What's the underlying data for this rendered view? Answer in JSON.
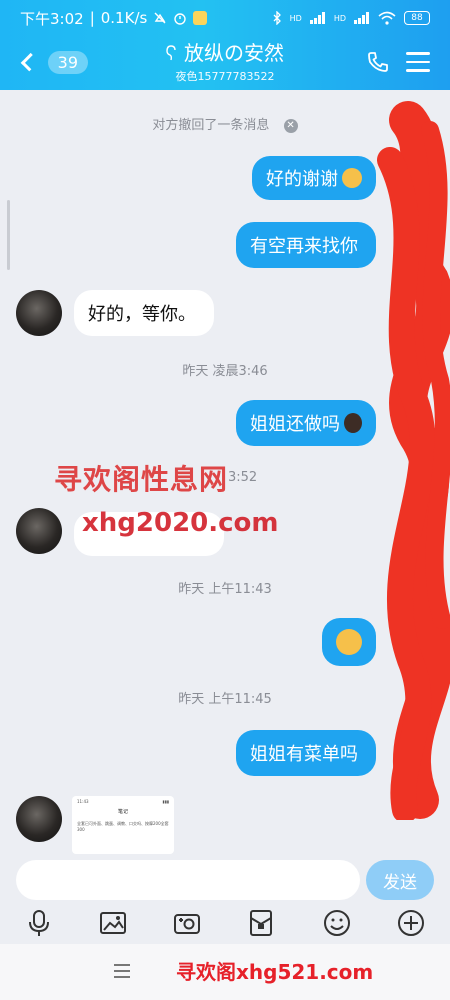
{
  "status_bar": {
    "time": "下午3:02",
    "speed": "0.1K/s",
    "battery": "88",
    "signal1": "HD",
    "signal2": "HD"
  },
  "header": {
    "back_count": "39",
    "title": "放纵の安然",
    "subtitle": "夜色15777783522"
  },
  "chat": {
    "recall_notice": "对方撤回了一条消息",
    "messages": [
      {
        "side": "me",
        "text": "好的谢谢"
      },
      {
        "side": "me",
        "text": "有空再来找你"
      },
      {
        "side": "them",
        "text": "好的，等你。"
      },
      {
        "side": "time",
        "text": "昨天 凌晨3:46"
      },
      {
        "side": "me",
        "text": "姐姐还做吗"
      },
      {
        "side": "time",
        "text": "昨天 上午11:43"
      },
      {
        "side": "time",
        "text": "昨天 上午11:45"
      },
      {
        "side": "me",
        "text": "姐姐有菜单吗"
      }
    ],
    "partial_time": "3:52",
    "note_card": {
      "header_left": "11:43",
      "title": "笔记",
      "body": "全套已可外面、跳蛋、调教、口交吗、按摩200全套300"
    }
  },
  "input": {
    "placeholder": "",
    "send_label": "发送"
  },
  "toolbar": {
    "icons": [
      "mic-icon",
      "image-icon",
      "camera-icon",
      "red-packet-icon",
      "emoji-icon",
      "plus-icon"
    ]
  },
  "watermarks": {
    "overlay_cn": "寻欢阁性息网",
    "overlay_url": "xhg2020.com",
    "footer": "寻欢阁xhg521.com"
  },
  "colors": {
    "header_blue": "#1fb6f5",
    "bubble_blue": "#1fa4f0",
    "bg": "#eceef3",
    "scribble_red": "#ee3324"
  }
}
